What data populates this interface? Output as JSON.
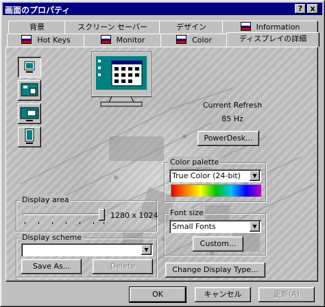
{
  "window": {
    "title": "画面のプロパティ",
    "help_label": "?",
    "close_label": "x"
  },
  "tabs_back": [
    "背景",
    "スクリーン セーバー",
    "デザイン",
    "Information"
  ],
  "tabs_front": [
    "Hot Keys",
    "Monitor",
    "Color",
    "ディスプレイの詳細"
  ],
  "refresh": {
    "label": "Current Refresh",
    "value": "85 Hz"
  },
  "powerdesk_label": "PowerDesk...",
  "color_palette": {
    "legend": "Color palette",
    "value": "True Color (24-bit)"
  },
  "display_area": {
    "legend": "Display area",
    "value": "1280 x 1024",
    "slider_fraction": 1.0
  },
  "font_size": {
    "legend": "Font size",
    "value": "Small Fonts",
    "custom_label": "Custom..."
  },
  "display_scheme": {
    "legend": "Display scheme",
    "value": "",
    "save_label": "Save As...",
    "delete_label": "Delete"
  },
  "change_type_label": "Change Display Type...",
  "footer": {
    "ok": "OK",
    "cancel": "キャンセル",
    "apply": "更新(A)"
  },
  "colors": {
    "titlebar": "#000080",
    "face": "#c0c0c0",
    "monitor_screen": "#008080"
  }
}
